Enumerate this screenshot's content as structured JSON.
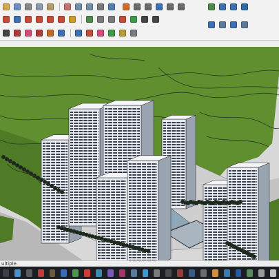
{
  "status_bar": {
    "text": "ultiple."
  },
  "toolbar": {
    "row1": [
      {
        "name": "open-icon",
        "color": "#d4a74a"
      },
      {
        "name": "save-icon",
        "color": "#6a8fc7"
      },
      {
        "name": "cut-icon",
        "color": "#888888"
      },
      {
        "name": "copy-icon",
        "color": "#8d9bb0"
      },
      {
        "name": "paste-icon",
        "color": "#b89b6a"
      },
      {
        "name": "erase-icon",
        "color": "#c86f6f"
      },
      {
        "name": "undo-icon",
        "color": "#6f8fa8"
      },
      {
        "name": "redo-icon",
        "color": "#6f8fa8"
      },
      {
        "name": "print-icon",
        "color": "#7a7a7a"
      },
      {
        "name": "model-info-icon",
        "color": "#4f7fb0"
      }
    ],
    "row1_right": [
      {
        "name": "iso-view-icon",
        "color": "#d06a2a"
      },
      {
        "name": "top-view-icon",
        "color": "#6a6a6a"
      },
      {
        "name": "front-view-icon",
        "color": "#6a6a6a"
      },
      {
        "name": "right-view-icon",
        "color": "#3c6fb4"
      },
      {
        "name": "back-view-icon",
        "color": "#6a6a6a"
      },
      {
        "name": "left-view-icon",
        "color": "#6a6a6a"
      }
    ],
    "row1_far": [
      {
        "name": "orbit-icon",
        "color": "#4a8a4a"
      },
      {
        "name": "xray-icon",
        "color": "#3c6fb4"
      },
      {
        "name": "shaded-icon",
        "color": "#3c6fb4"
      },
      {
        "name": "textured-icon",
        "color": "#2f6aa8"
      }
    ],
    "row2": [
      {
        "name": "rotate-icon",
        "color": "#c24b3a"
      },
      {
        "name": "move-icon",
        "color": "#3c6fb4"
      },
      {
        "name": "scale-icon",
        "color": "#c24b3a"
      },
      {
        "name": "push-pull-icon",
        "color": "#c24b3a"
      },
      {
        "name": "follow-me-icon",
        "color": "#c24b3a"
      },
      {
        "name": "offset-icon",
        "color": "#c24b3a"
      },
      {
        "name": "tape-measure-icon",
        "color": "#d09a2a"
      },
      {
        "name": "dimension-icon",
        "color": "#4b8a4b"
      },
      {
        "name": "protractor-icon",
        "color": "#7a7a7a"
      },
      {
        "name": "text-icon",
        "color": "#7a7a7a"
      },
      {
        "name": "axes-icon",
        "color": "#c24b3a"
      },
      {
        "name": "paint-bucket-icon",
        "color": "#3c9a4a"
      },
      {
        "name": "zoom-icon",
        "color": "#444444"
      },
      {
        "name": "pan-icon",
        "color": "#444444"
      }
    ],
    "row3": [
      {
        "name": "select-icon",
        "color": "#444444"
      },
      {
        "name": "component-icon",
        "color": "#b03a3a"
      },
      {
        "name": "eraser-icon",
        "color": "#d64a7a"
      },
      {
        "name": "line-icon",
        "color": "#b03a3a"
      },
      {
        "name": "arc-icon",
        "color": "#c26a2a"
      },
      {
        "name": "rectangle-icon",
        "color": "#3c6fb4"
      },
      {
        "name": "circle-icon",
        "color": "#3c6fb4"
      },
      {
        "name": "polygon-icon",
        "color": "#c24b3a"
      },
      {
        "name": "section-icon",
        "color": "#d64a7a"
      },
      {
        "name": "walk-icon",
        "color": "#3c9a4a"
      },
      {
        "name": "look-around-icon",
        "color": "#b89a3a"
      },
      {
        "name": "position-camera-icon",
        "color": "#7a7a7a"
      }
    ],
    "standard_views": [
      {
        "name": "view-arrow-icon",
        "color": "#3c6fb4"
      },
      {
        "name": "iso-box-icon",
        "color": "#5a7a9a"
      },
      {
        "name": "top-box-icon",
        "color": "#3c6fb4"
      },
      {
        "name": "front-box-icon",
        "color": "#5a7a9a"
      }
    ]
  },
  "taskbar": {
    "items": [
      {
        "name": "windows-start-icon",
        "color": "#3a3f47"
      },
      {
        "name": "taskbar-app-1-icon",
        "color": "#4a8fd0"
      },
      {
        "name": "taskbar-app-2-icon",
        "color": "#5a5a5a"
      },
      {
        "name": "taskbar-app-3-icon",
        "color": "#c23a3a"
      },
      {
        "name": "taskbar-app-4-icon",
        "color": "#6a5a3a"
      },
      {
        "name": "taskbar-app-5-icon",
        "color": "#3a6ab0"
      },
      {
        "name": "taskbar-app-6-icon",
        "color": "#4a9a4a"
      },
      {
        "name": "taskbar-app-7-icon",
        "color": "#d23a3a"
      },
      {
        "name": "taskbar-app-8-icon",
        "color": "#3a8ab0"
      },
      {
        "name": "taskbar-app-9-icon",
        "color": "#7a5ab0"
      },
      {
        "name": "taskbar-app-10-icon",
        "color": "#b0306a"
      },
      {
        "name": "taskbar-app-11-icon",
        "color": "#5a7a9a"
      },
      {
        "name": "taskbar-app-12-icon",
        "color": "#3a9ad0"
      },
      {
        "name": "taskbar-app-13-icon",
        "color": "#7a7a7a"
      },
      {
        "name": "taskbar-app-14-icon",
        "color": "#4a4a4a"
      },
      {
        "name": "taskbar-app-15-icon",
        "color": "#9a3a3a"
      },
      {
        "name": "taskbar-app-16-icon",
        "color": "#3a5a8a"
      },
      {
        "name": "taskbar-app-17-icon",
        "color": "#6a6a6a"
      },
      {
        "name": "taskbar-app-18-icon",
        "color": "#d0903a"
      },
      {
        "name": "taskbar-app-19-icon",
        "color": "#3a7ab0"
      },
      {
        "name": "taskbar-app-20-icon",
        "color": "#2a5a9a"
      },
      {
        "name": "taskbar-app-21-icon",
        "color": "#5a8a5a"
      },
      {
        "name": "taskbar-app-22-icon",
        "color": "#9a9a9a"
      },
      {
        "name": "taskbar-app-23-icon",
        "color": "#c0c0c0"
      }
    ]
  },
  "viewport": {
    "terrain_color": "#5f8f2e",
    "terrain_shade": "#4a7424",
    "contour_color": "#2b3a1f",
    "ground_color": "#d8d8d8",
    "road_color": "#a8a8a8",
    "tower_face": "#e6e9ef",
    "tower_window": "#3a4250",
    "tree_color": "#1f2a1f",
    "pool_color": "#8fa8b8"
  }
}
